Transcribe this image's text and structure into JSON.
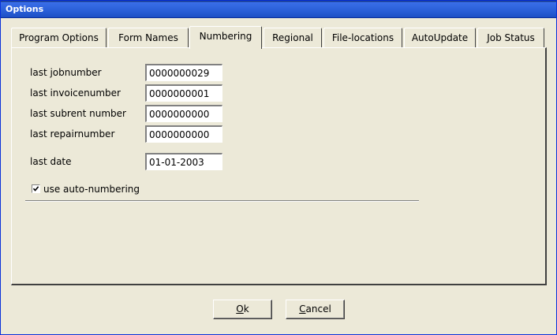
{
  "window": {
    "title": "Options"
  },
  "tabs": [
    {
      "label": "Program Options",
      "active": false
    },
    {
      "label": "Form Names",
      "active": false
    },
    {
      "label": "Numbering",
      "active": true
    },
    {
      "label": "Regional",
      "active": false
    },
    {
      "label": "File-locations",
      "active": false
    },
    {
      "label": "AutoUpdate",
      "active": false
    },
    {
      "label": "Job Status",
      "active": false
    }
  ],
  "numbering": {
    "last_jobnumber_label": "last jobnumber",
    "last_jobnumber": "0000000029",
    "last_invoicenumber_label": "last invoicenumber",
    "last_invoicenumber": "0000000001",
    "last_subrent_label": "last subrent number",
    "last_subrent": "0000000000",
    "last_repair_label": "last repairnumber",
    "last_repair": "0000000000",
    "last_date_label": "last date",
    "last_date": "01-01-2003",
    "auto_numbering_label": "use auto-numbering",
    "auto_numbering_checked": true
  },
  "buttons": {
    "ok_accel": "O",
    "ok_rest": "k",
    "cancel_accel": "C",
    "cancel_rest": "ancel"
  }
}
